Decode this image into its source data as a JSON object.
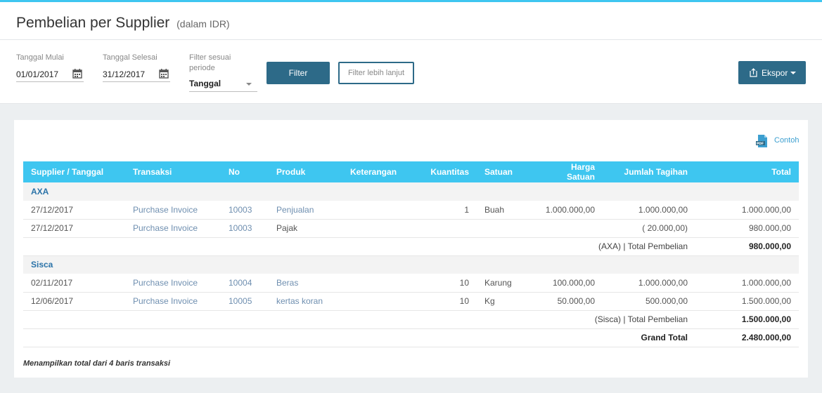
{
  "header": {
    "title": "Pembelian per Supplier",
    "subtitle": "(dalam IDR)"
  },
  "filters": {
    "start": {
      "label": "Tanggal Mulai",
      "value": "01/01/2017",
      "icon": "calendar-icon"
    },
    "end": {
      "label": "Tanggal Selesai",
      "value": "31/12/2017",
      "icon": "calendar-icon"
    },
    "period": {
      "label_line1": "Filter sesuai",
      "label_line2": "periode",
      "value": "Tanggal"
    },
    "filter_button": "Filter",
    "advanced_button": "Filter lebih lanjut",
    "export_button": "Ekspor"
  },
  "sample": {
    "label": "Contoh",
    "icon": "pdf-icon"
  },
  "colors": {
    "accent": "#3ec6f0",
    "primary": "#2d6a88",
    "link": "#6f8fb0",
    "group": "#2b73a8"
  },
  "table": {
    "columns": [
      "Supplier / Tanggal",
      "Transaksi",
      "No",
      "Produk",
      "Keterangan",
      "Kuantitas",
      "Satuan",
      "Harga Satuan",
      "Jumlah Tagihan",
      "Total"
    ],
    "groups": [
      {
        "name": "AXA",
        "rows": [
          {
            "date": "27/12/2017",
            "type": "Purchase Invoice",
            "no": "10003",
            "product": "Penjualan",
            "note": "",
            "qty": "1",
            "unit": "Buah",
            "price": "1.000.000,00",
            "amount": "1.000.000,00",
            "total": "1.000.000,00"
          },
          {
            "date": "27/12/2017",
            "type": "Purchase Invoice",
            "no": "10003",
            "product": "Pajak",
            "note": "",
            "qty": "",
            "unit": "",
            "price": "",
            "amount": "( 20.000,00)",
            "total": "980.000,00"
          }
        ],
        "subtotal_label": "(AXA) | Total Pembelian",
        "subtotal": "980.000,00"
      },
      {
        "name": "Sisca",
        "rows": [
          {
            "date": "02/11/2017",
            "type": "Purchase Invoice",
            "no": "10004",
            "product": "Beras",
            "note": "",
            "qty": "10",
            "unit": "Karung",
            "price": "100.000,00",
            "amount": "1.000.000,00",
            "total": "1.000.000,00"
          },
          {
            "date": "12/06/2017",
            "type": "Purchase Invoice",
            "no": "10005",
            "product": "kertas koran",
            "note": "",
            "qty": "10",
            "unit": "Kg",
            "price": "50.000,00",
            "amount": "500.000,00",
            "total": "1.500.000,00"
          }
        ],
        "subtotal_label": "(Sisca) | Total Pembelian",
        "subtotal": "1.500.000,00"
      }
    ],
    "grand_total_label": "Grand Total",
    "grand_total": "2.480.000,00"
  },
  "footnote": "Menampilkan total dari 4 baris transaksi"
}
